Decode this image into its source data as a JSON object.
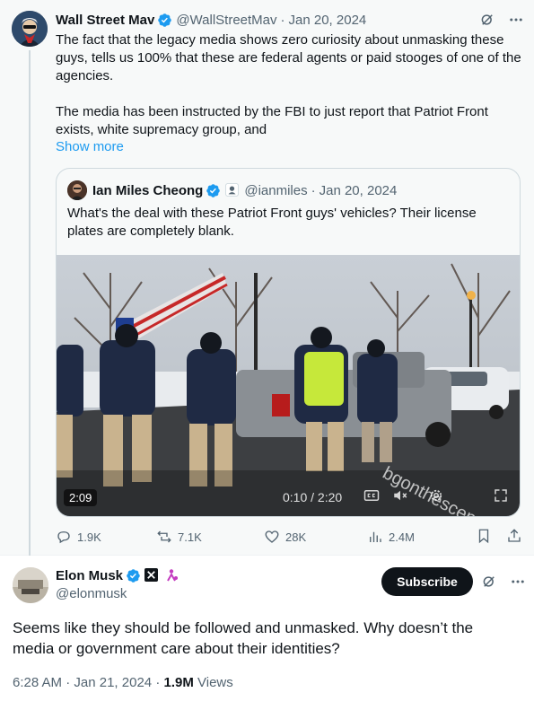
{
  "reply": {
    "display_name": "Wall Street Mav",
    "handle": "@WallStreetMav",
    "dot": "·",
    "date": "Jan 20, 2024",
    "text": "The fact that the legacy media shows zero curiosity about unmasking these guys, tells us 100% that these are federal agents or paid stooges of one of the agencies.\n\nThe media has been instructed by the FBI to just report that Patriot Front exists, white supremacy group, and",
    "show_more": "Show more",
    "icons": {
      "grok": "grok-icon",
      "more": "more-icon"
    }
  },
  "quote": {
    "display_name": "Ian Miles Cheong",
    "handle": "@ianmiles",
    "dot": "·",
    "date": "Jan 20, 2024",
    "text": "What's the deal with these Patriot Front guys' vehicles? Their license plates are completely blank.",
    "video": {
      "duration_badge": "2:09",
      "progress_time": "0:10 / 2:20",
      "watermark": "bgonthescene"
    }
  },
  "actions": {
    "replies": "1.9K",
    "reposts": "7.1K",
    "likes": "28K",
    "views": "2.4M"
  },
  "main": {
    "display_name": "Elon Musk",
    "handle": "@elonmusk",
    "subscribe_label": "Subscribe",
    "text": "Seems like they should be followed and unmasked. Why doesn’t the media or government care about their identities?",
    "time": "6:28 AM",
    "dot": "·",
    "date": "Jan 21, 2024",
    "views_count": "1.9M",
    "views_label": "Views"
  },
  "colors": {
    "accent": "#1d9bf0",
    "text": "#0f1419",
    "muted": "#536471",
    "verified": "#1d9bf0"
  }
}
